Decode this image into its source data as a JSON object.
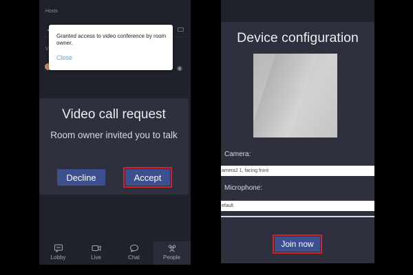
{
  "left_screen": {
    "hosts_label": "Hosts",
    "section_initial": "V",
    "toast": {
      "message": "Granted access to video conference by room owner.",
      "close_label": "Close"
    },
    "call_dialog": {
      "title": "Video call request",
      "message": "Room owner invited you to talk",
      "decline_label": "Decline",
      "accept_label": "Accept"
    },
    "bottom_nav": [
      {
        "label": "Lobby",
        "icon": "chat-bubble-icon"
      },
      {
        "label": "Live",
        "icon": "video-camera-icon"
      },
      {
        "label": "Chat",
        "icon": "chat-icon"
      },
      {
        "label": "People",
        "icon": "people-icon"
      }
    ]
  },
  "right_screen": {
    "title": "Device configuration",
    "camera_label": "Camera:",
    "camera_value": "amera2 1, facing front",
    "microphone_label": "Microphone:",
    "microphone_value": "efault",
    "join_label": "Join now"
  },
  "colors": {
    "background": "#000000",
    "panel": "#1f212b",
    "dialog": "#2e313d",
    "button": "#3c4f8f",
    "highlight_border": "#d62028",
    "link": "#6aa4c8"
  }
}
